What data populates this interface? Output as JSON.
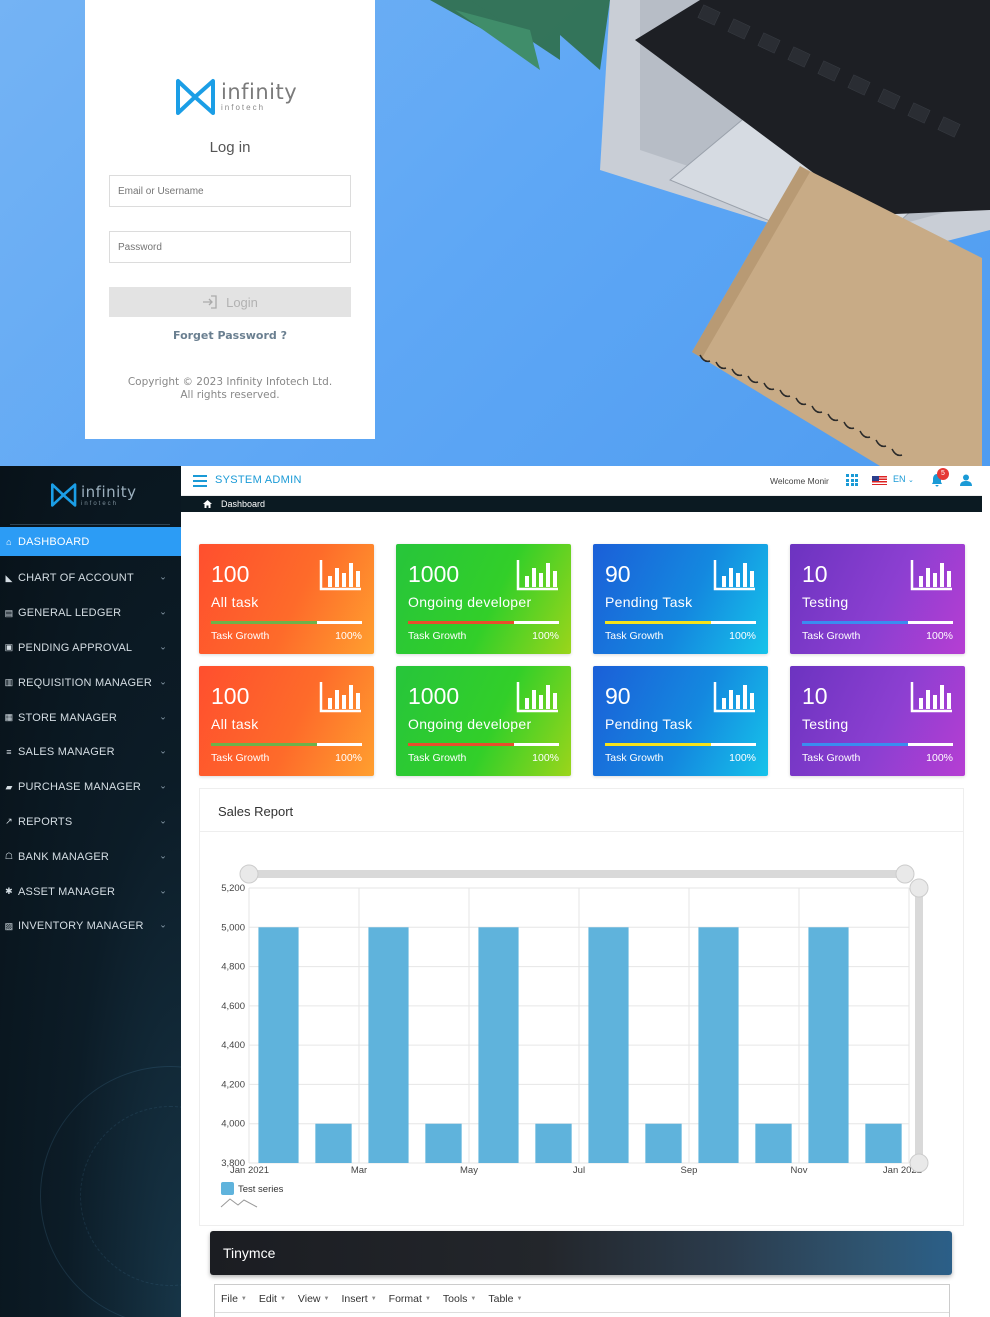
{
  "login": {
    "logo_word": "infinity",
    "logo_sub": "infotech",
    "title": "Log in",
    "email_placeholder": "Email or Username",
    "password_placeholder": "Password",
    "login_button": "Login",
    "forget_password": "Forget Password ?",
    "copyright_line1": "Copyright © 2023 Infinity Infotech Ltd.",
    "copyright_line2": "All rights reserved."
  },
  "sidebar": {
    "logo_word": "infinity",
    "logo_sub": "infotech",
    "items": [
      {
        "label": "DASHBOARD",
        "icon": "home-icon",
        "active": true
      },
      {
        "label": "CHART OF ACCOUNT",
        "icon": "area-chart-icon"
      },
      {
        "label": "GENERAL LEDGER",
        "icon": "ledger-icon"
      },
      {
        "label": "PENDING APPROVAL",
        "icon": "lock-icon"
      },
      {
        "label": "REQUISITION MANAGER",
        "icon": "file-icon"
      },
      {
        "label": "STORE MANAGER",
        "icon": "store-icon"
      },
      {
        "label": "SALES MANAGER",
        "icon": "cart-icon"
      },
      {
        "label": "PURCHASE MANAGER",
        "icon": "bag-icon"
      },
      {
        "label": "REPORTS",
        "icon": "line-chart-icon"
      },
      {
        "label": "BANK MANAGER",
        "icon": "bank-icon"
      },
      {
        "label": "ASSET MANAGER",
        "icon": "gear-icon"
      },
      {
        "label": "INVENTORY MANAGER",
        "icon": "box-icon"
      }
    ]
  },
  "topbar": {
    "title": "SYSTEM ADMIN",
    "welcome": "Welcome Monir",
    "language": "EN",
    "notification_count": "5"
  },
  "breadcrumb": {
    "label": "Dashboard"
  },
  "cards": [
    {
      "value": "100",
      "label": "All task",
      "growth_label": "Task Growth",
      "growth_pct": "100%",
      "theme": "orange",
      "bar_color": "#6cb24a"
    },
    {
      "value": "1000",
      "label": "Ongoing developer",
      "growth_label": "Task Growth",
      "growth_pct": "100%",
      "theme": "green",
      "bar_color": "#e84e2c"
    },
    {
      "value": "90",
      "label": "Pending Task",
      "growth_label": "Task Growth",
      "growth_pct": "100%",
      "theme": "blue",
      "bar_color": "#f6e21a"
    },
    {
      "value": "10",
      "label": "Testing",
      "growth_label": "Task Growth",
      "growth_pct": "100%",
      "theme": "purple",
      "bar_color": "#3a8cf0"
    },
    {
      "value": "100",
      "label": "All task",
      "growth_label": "Task Growth",
      "growth_pct": "100%",
      "theme": "orange",
      "bar_color": "#6cb24a"
    },
    {
      "value": "1000",
      "label": "Ongoing developer",
      "growth_label": "Task Growth",
      "growth_pct": "100%",
      "theme": "green",
      "bar_color": "#e84e2c"
    },
    {
      "value": "90",
      "label": "Pending Task",
      "growth_label": "Task Growth",
      "growth_pct": "100%",
      "theme": "blue",
      "bar_color": "#f6e21a"
    },
    {
      "value": "10",
      "label": "Testing",
      "growth_label": "Task Growth",
      "growth_pct": "100%",
      "theme": "purple",
      "bar_color": "#3a8cf0"
    }
  ],
  "sales_report": {
    "title": "Sales Report"
  },
  "chart_data": {
    "type": "bar",
    "title": "",
    "series": [
      {
        "name": "Test series",
        "values": [
          5000,
          4000,
          5000,
          4000,
          5000,
          4000,
          5000,
          4000,
          5000,
          4000,
          5000,
          4000
        ]
      }
    ],
    "x_ticks": [
      "Jan 2021",
      "Mar",
      "May",
      "Jul",
      "Sep",
      "Nov",
      "Jan 2022"
    ],
    "y_ticks": [
      "3,800",
      "4,000",
      "4,200",
      "4,400",
      "4,600",
      "4,800",
      "5,000",
      "5,200"
    ],
    "ylim": [
      3800,
      5200
    ],
    "bar_color": "#5fb3dc",
    "grid": true,
    "legend": "bottom-left"
  },
  "tinymce": {
    "title": "Tinymce",
    "menu": [
      "File",
      "Edit",
      "View",
      "Insert",
      "Format",
      "Tools",
      "Table"
    ]
  }
}
